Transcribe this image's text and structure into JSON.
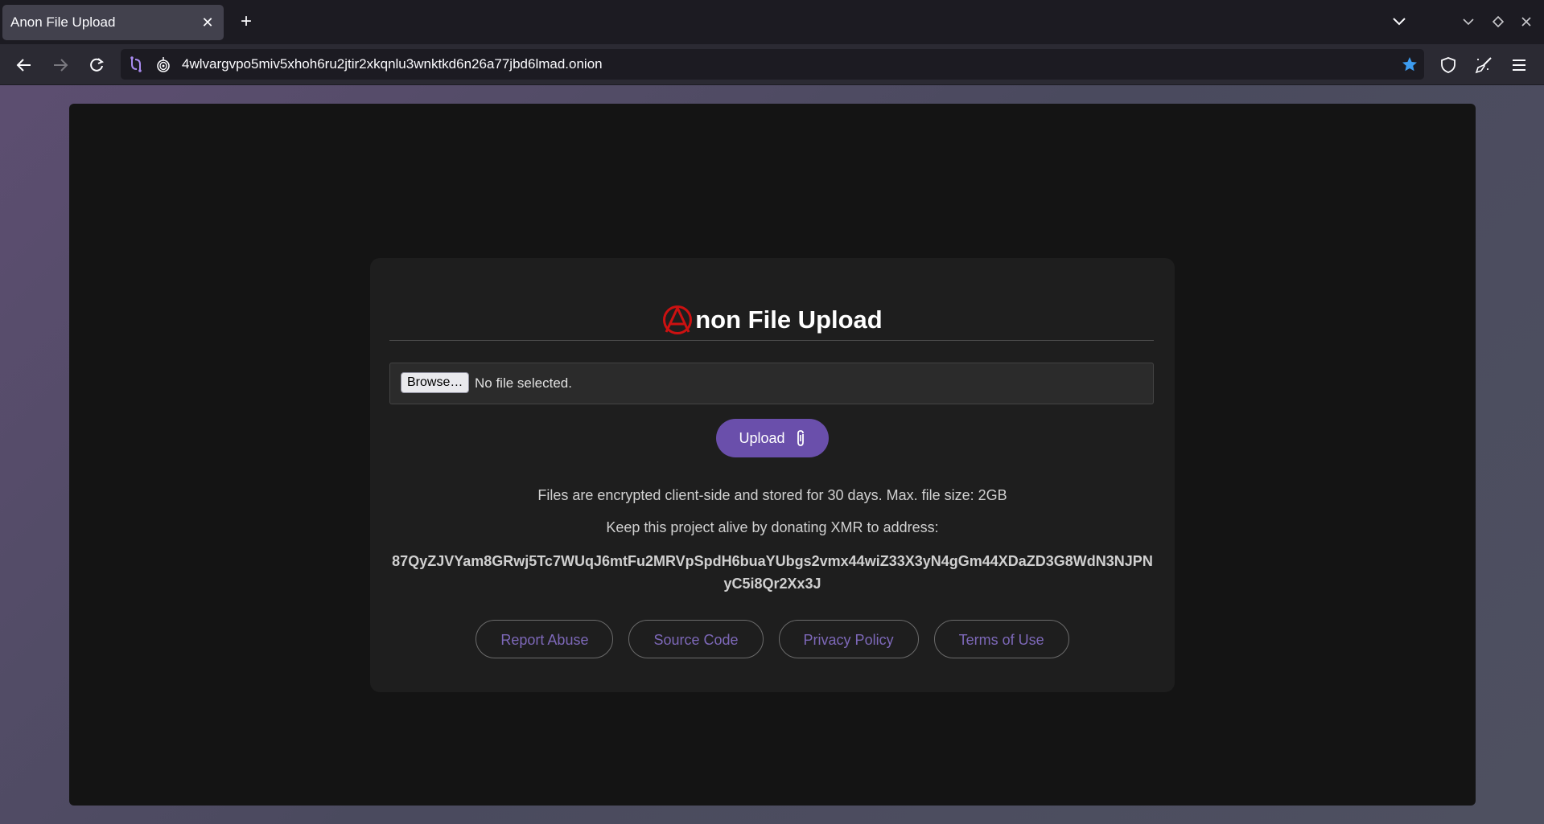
{
  "browser": {
    "tab_title": "Anon File Upload",
    "url": "4wlvargvpo5miv5xhoh6ru2jtir2xkqnlu3wnktkd6n26a77jbd6lmad.onion",
    "accent_color": "#3d9cf0"
  },
  "page": {
    "title_rest": "non File Upload",
    "logo_icon": "anarchy-a-icon",
    "logo_color": "#cc1111",
    "file_input": {
      "button_label": "Browse…",
      "status": "No file selected."
    },
    "upload_button": {
      "label": "Upload",
      "icon": "paperclip-icon",
      "color": "#6a4fab"
    },
    "info_text": "Files are encrypted client-side and stored for 30 days. Max. file size: 2GB",
    "donate_text": "Keep this project alive by donating XMR to address:",
    "xmr_address": "87QyZJVYam8GRwj5Tc7WUqJ6mtFu2MRVpSpdH6buaYUbgs2vmx44wiZ33X3yN4gGm44XDaZD3G8WdN3NJPNyC5i8Qr2Xx3J",
    "footer_links": [
      "Report Abuse",
      "Source Code",
      "Privacy Policy",
      "Terms of Use"
    ]
  }
}
